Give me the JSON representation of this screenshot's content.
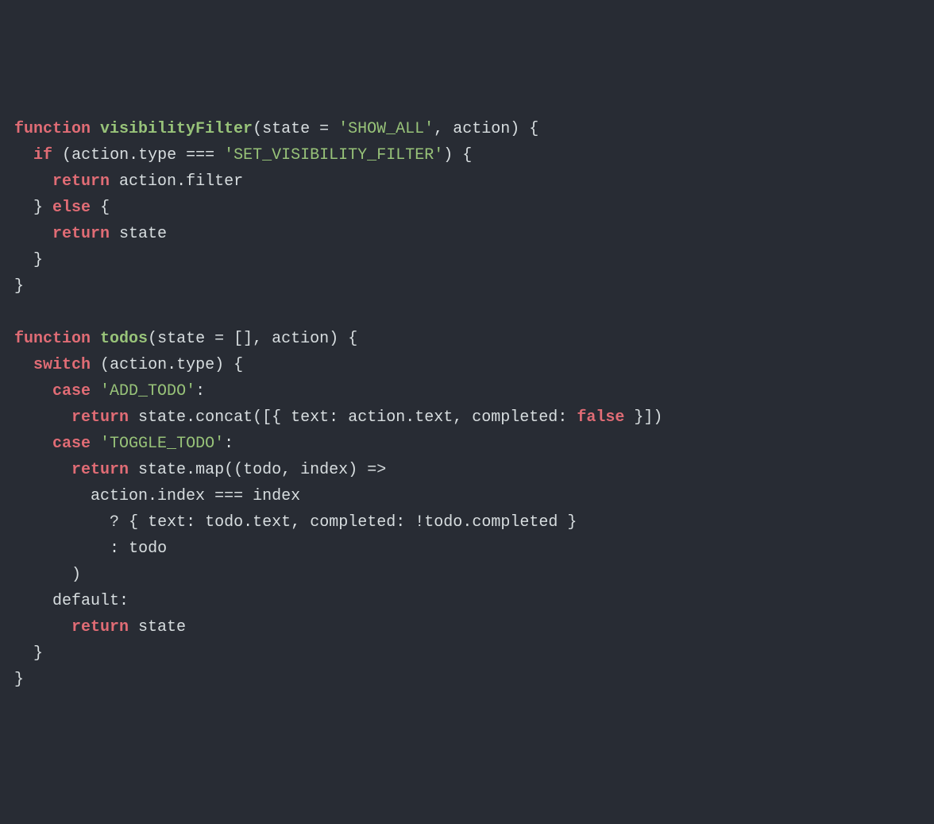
{
  "tokens": {
    "kw_function": "function",
    "kw_if": "if",
    "kw_else": "else",
    "kw_return": "return",
    "kw_switch": "switch",
    "kw_case": "case",
    "kw_default": "default",
    "kw_false": "false",
    "fn_visibilityFilter": "visibilityFilter",
    "fn_todos": "todos",
    "str_show_all": "'SHOW_ALL'",
    "str_set_vis": "'SET_VISIBILITY_FILTER'",
    "str_add_todo": "'ADD_TODO'",
    "str_toggle_todo": "'TOGGLE_TODO'",
    "id_state": "state",
    "id_action": "action",
    "id_type": "type",
    "id_filter": "filter",
    "id_concat": "concat",
    "id_text": "text",
    "id_completed": "completed",
    "id_map": "map",
    "id_todo": "todo",
    "id_index": "index",
    "p_open_paren": "(",
    "p_close_paren": ")",
    "p_open_brace": "{",
    "p_close_brace": "}",
    "p_open_bracket": "[",
    "p_close_bracket": "]",
    "p_eq": "=",
    "p_triple_eq": "===",
    "p_comma": ",",
    "p_dot": ".",
    "p_colon": ":",
    "p_bang": "!",
    "p_arrow": "=>",
    "p_question": "?",
    "p_empty_arr": "[]",
    "sp": " ",
    "sp2": "  ",
    "sp4": "    ",
    "sp6": "      ",
    "sp8": "        ",
    "sp10": "          ",
    "nl": "\n"
  }
}
